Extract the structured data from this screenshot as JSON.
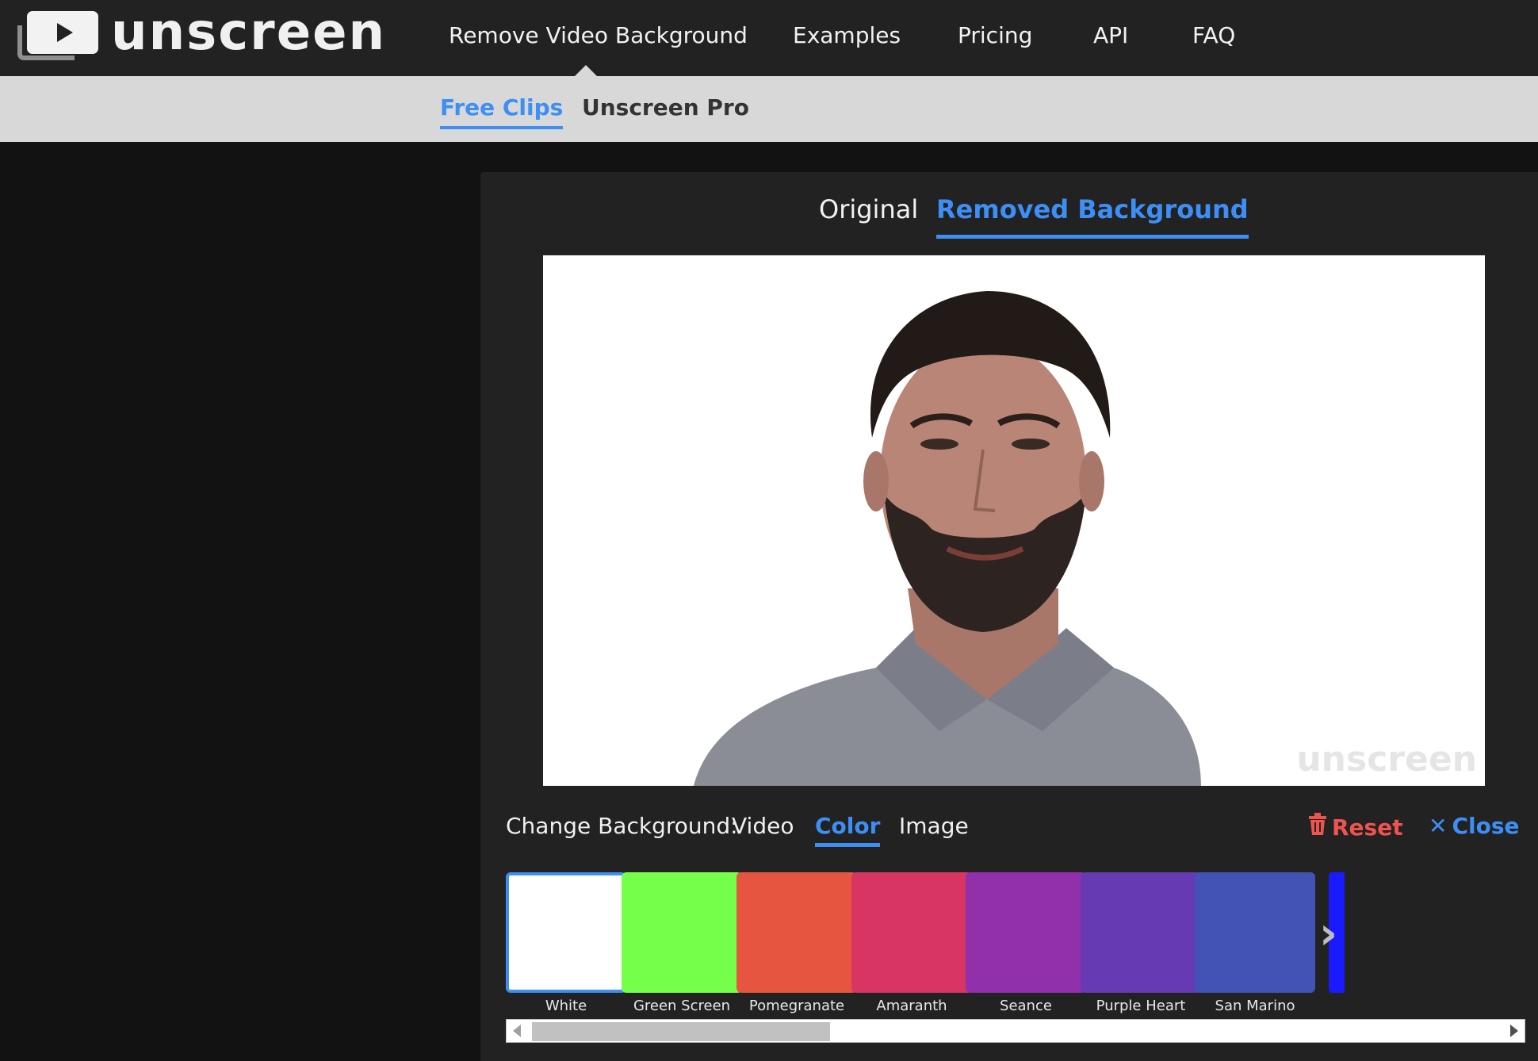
{
  "header": {
    "brand": "unscreen",
    "nav": [
      "Remove Video Background",
      "Examples",
      "Pricing",
      "API",
      "FAQ"
    ]
  },
  "subnav": {
    "tabs": [
      "Free Clips",
      "Unscreen Pro"
    ],
    "active": "Free Clips"
  },
  "viewer": {
    "tabs": [
      "Original",
      "Removed Background"
    ],
    "active": "Removed Background",
    "watermark": "unscreen"
  },
  "background_controls": {
    "label": "Change Background:",
    "options": [
      "Video",
      "Color",
      "Image"
    ],
    "active": "Color",
    "reset_label": "Reset",
    "close_label": "Close"
  },
  "swatches": [
    {
      "name": "White",
      "color": "#ffffff"
    },
    {
      "name": "Green Screen",
      "color": "#76ff4a"
    },
    {
      "name": "Pomegranate",
      "color": "#e65540"
    },
    {
      "name": "Amaranth",
      "color": "#d93563"
    },
    {
      "name": "Seance",
      "color": "#9230ab"
    },
    {
      "name": "Purple Heart",
      "color": "#663ab3"
    },
    {
      "name": "San Marino",
      "color": "#4352b5"
    }
  ],
  "accent_color": "#3d8ef5",
  "reset_color": "#ef5350"
}
